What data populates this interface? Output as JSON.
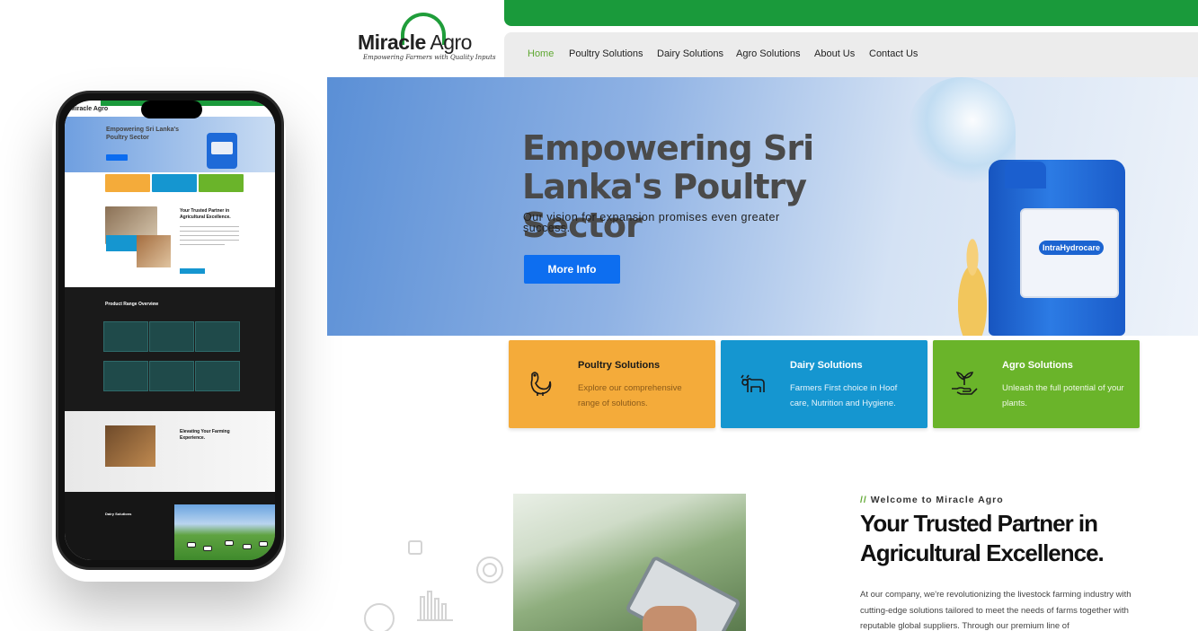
{
  "brand": {
    "logo_text_bold": "Miracle",
    "logo_text_light": "Agro",
    "tagline": "Empowering Farmers with Quality Inputs"
  },
  "nav": {
    "items": [
      {
        "label": "Home",
        "active": true
      },
      {
        "label": "Poultry Solutions",
        "active": false
      },
      {
        "label": "Dairy Solutions",
        "active": false
      },
      {
        "label": "Agro Solutions",
        "active": false
      },
      {
        "label": "About Us",
        "active": false
      },
      {
        "label": "Contact Us",
        "active": false
      }
    ]
  },
  "hero": {
    "title": "Empowering Sri Lanka's Poultry Sector",
    "subtitle": "Our vision for expansion promises even greater success.",
    "button_label": "More Info",
    "product_brand": "IntraHydrocare"
  },
  "cards": [
    {
      "title": "Poultry Solutions",
      "description": "Explore our comprehensive range of solutions.",
      "color": "#f4ab3a",
      "title_color": "#1a1a1a",
      "desc_color": "#8a5a1a",
      "icon": "hen-icon"
    },
    {
      "title": "Dairy Solutions",
      "description": "Farmers First choice in Hoof care, Nutrition and Hygiene.",
      "color": "#1596d0",
      "title_color": "#ffffff",
      "desc_color": "#e8f4fb",
      "icon": "cow-icon"
    },
    {
      "title": "Agro Solutions",
      "description": "Unleash the full potential of your plants.",
      "color": "#6ab42a",
      "title_color": "#ffffff",
      "desc_color": "#f0f8e8",
      "icon": "plant-hand-icon"
    }
  ],
  "welcome": {
    "tag_prefix": "//",
    "tag": "Welcome to Miracle Agro",
    "title": "Your Trusted Partner in Agricultural Excellence.",
    "body": "At our company, we're revolutionizing the livestock farming industry with cutting-edge solutions tailored to meet the needs of farms together with reputable global suppliers. Through our premium line of"
  },
  "mobile": {
    "hero_title": "Empowering Sri Lanka's Poultry Sector",
    "welcome_title": "Your Trusted Partner in Agricultural Excellence.",
    "section_title": "Product Range Overview",
    "gray_title": "Elevating Your Farming Experience.",
    "dairy_title": "Dairy Solutions"
  },
  "colors": {
    "accent_green": "#1a9a3b",
    "nav_active": "#5fa832",
    "button_blue": "#0d6ef0"
  }
}
